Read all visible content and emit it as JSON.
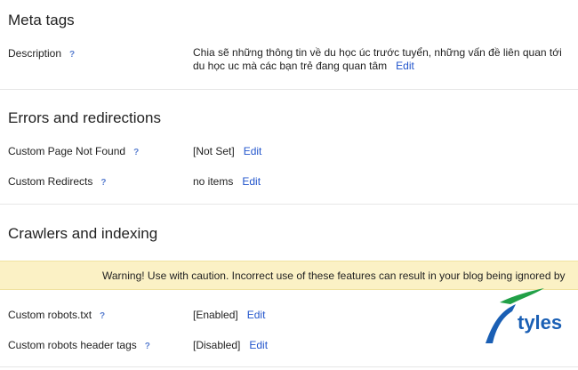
{
  "meta_tags": {
    "title": "Meta tags",
    "description": {
      "label": "Description",
      "help": "?",
      "value": "Chia sẽ những thông tin về du học úc trước tuyển, những vấn đề liên quan tới du học uc mà các bạn trẻ đang quan tâm",
      "edit": "Edit"
    }
  },
  "errors": {
    "title": "Errors and redirections",
    "not_found": {
      "label": "Custom Page Not Found",
      "help": "?",
      "value": "[Not Set]",
      "edit": "Edit"
    },
    "redirects": {
      "label": "Custom Redirects",
      "help": "?",
      "value": "no items",
      "edit": "Edit"
    }
  },
  "crawlers": {
    "title": "Crawlers and indexing",
    "warning": "Warning! Use with caution. Incorrect use of these features can result in your blog being ignored by",
    "robots_txt": {
      "label": "Custom robots.txt",
      "help": "?",
      "value": "[Enabled]",
      "edit": "Edit"
    },
    "robots_header": {
      "label": "Custom robots header tags",
      "help": "?",
      "value": "[Disabled]",
      "edit": "Edit"
    }
  },
  "logo": {
    "text": "tyles",
    "colors": {
      "blue": "#1a5fb4",
      "green": "#21a047"
    }
  }
}
